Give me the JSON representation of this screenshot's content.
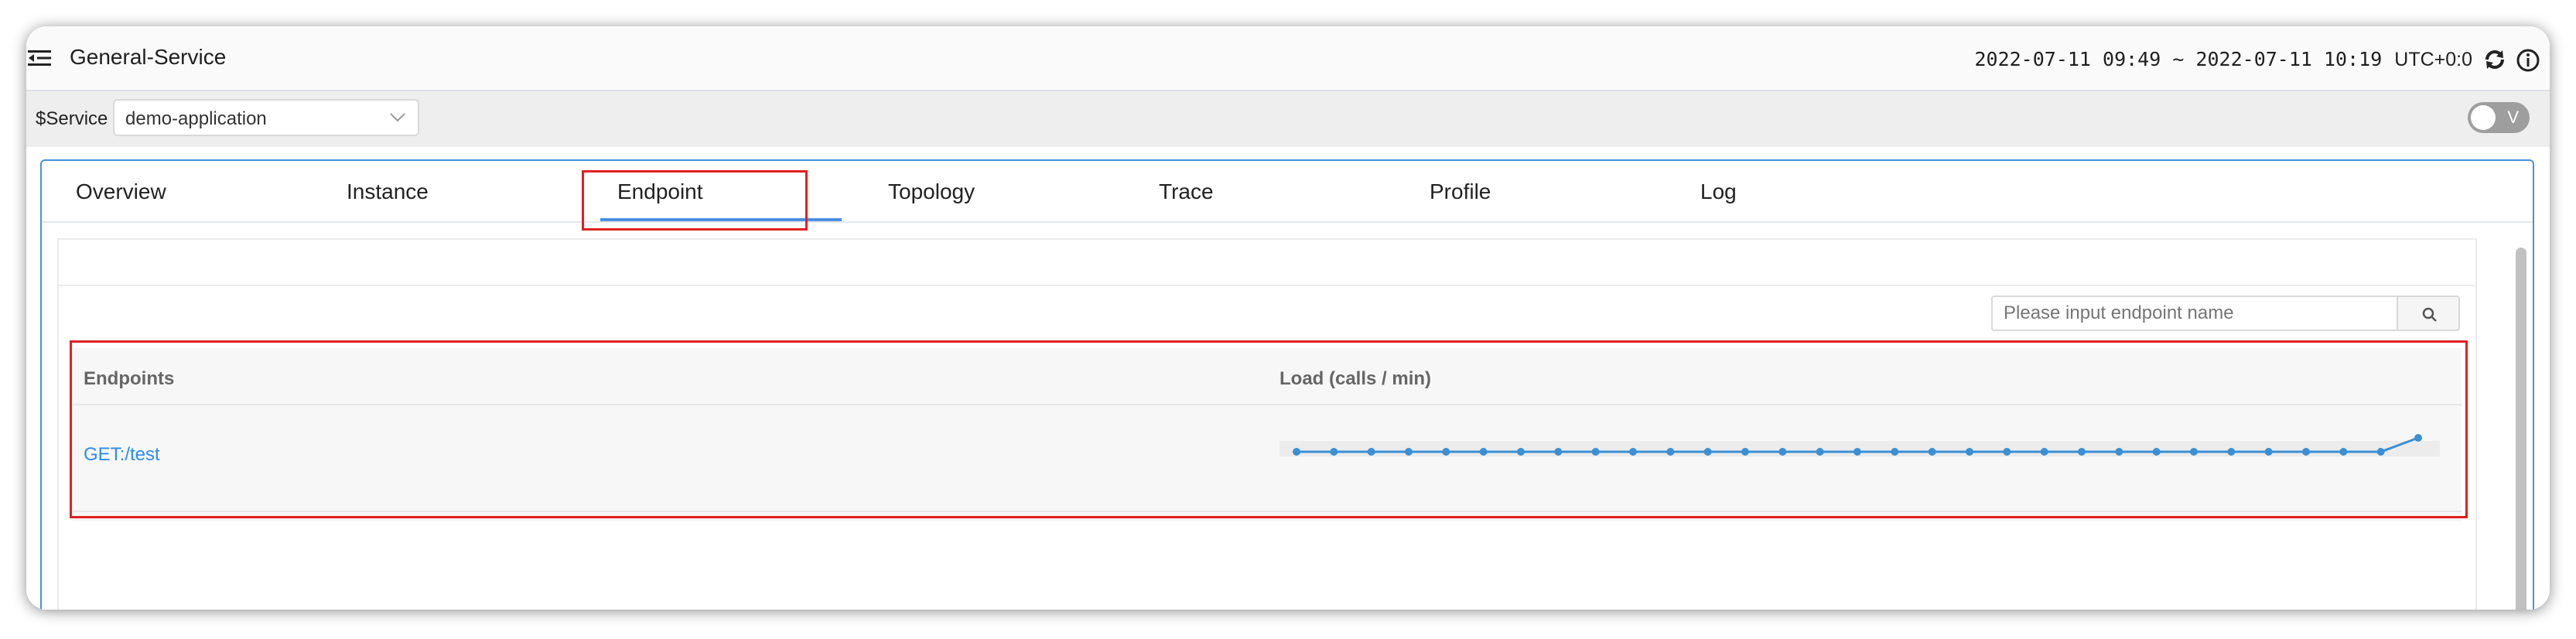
{
  "header": {
    "title": "General-Service",
    "time_range": "2022-07-11 09:49 ~ 2022-07-11 10:19",
    "timezone": "UTC+0:0"
  },
  "service_bar": {
    "label": "$Service",
    "selected": "demo-application",
    "toggle_label": "V"
  },
  "tabs": [
    {
      "label": "Overview"
    },
    {
      "label": "Instance"
    },
    {
      "label": "Endpoint",
      "active": true
    },
    {
      "label": "Topology"
    },
    {
      "label": "Trace"
    },
    {
      "label": "Profile"
    },
    {
      "label": "Log"
    }
  ],
  "search": {
    "placeholder": "Please input endpoint name"
  },
  "table": {
    "columns": [
      "Endpoints",
      "Load (calls / min)"
    ],
    "rows": [
      {
        "endpoint": "GET:/test",
        "load_series": [
          0,
          0,
          0,
          0,
          0,
          0,
          0,
          0,
          0,
          0,
          0,
          0,
          0,
          0,
          0,
          0,
          0,
          0,
          0,
          0,
          0,
          0,
          0,
          0,
          0,
          0,
          0,
          0,
          0,
          0,
          1
        ]
      }
    ]
  },
  "colors": {
    "accent": "#4a90e2",
    "link": "#2d8cf0",
    "highlight": "#e02020",
    "sparkline": "#3b8fd4"
  }
}
